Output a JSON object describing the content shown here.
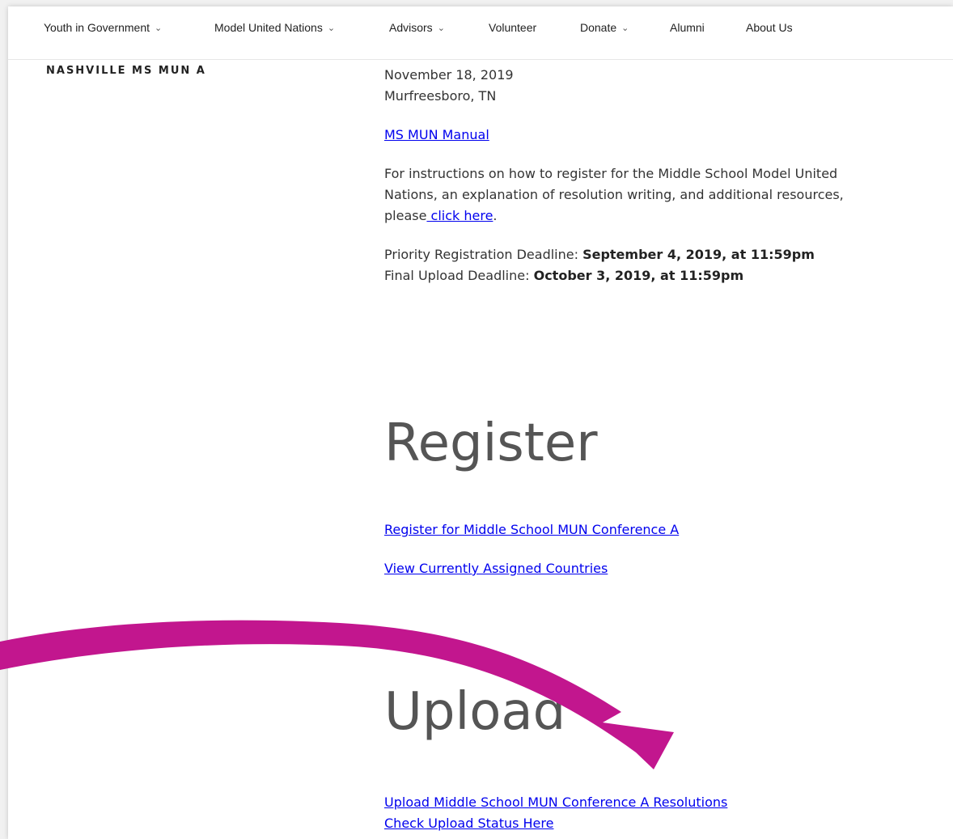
{
  "nav": {
    "items": [
      {
        "label": "Youth in Government",
        "caret": true
      },
      {
        "label": "Model United Nations",
        "caret": true
      },
      {
        "label": "Advisors",
        "caret": true
      },
      {
        "label": "Volunteer",
        "caret": false
      },
      {
        "label": "Donate",
        "caret": true
      },
      {
        "label": "Alumni",
        "caret": false
      },
      {
        "label": "About Us",
        "caret": false
      }
    ]
  },
  "sidebar": {
    "title": "NASHVILLE MS MUN A"
  },
  "event": {
    "date": "November 18, 2019",
    "location": "Murfreesboro, TN",
    "manual_link": "MS MUN Manual",
    "instructions_text": "For instructions on how to register for the Middle School Model United Nations, an explanation of resolution writing, and additional resources, please",
    "click_here_link": " click here",
    "instructions_end": ".",
    "priority_label": "Priority Registration Deadline: ",
    "priority_value": "September 4, 2019, at 11:59pm",
    "final_label": "Final Upload Deadline: ",
    "final_value": "October 3, 2019, at 11:59pm"
  },
  "register": {
    "heading": "Register",
    "register_link": "Register for Middle School MUN Conference A",
    "view_link": "View Currently Assigned Countries"
  },
  "upload": {
    "heading": "Upload",
    "upload_link": "Upload Middle School MUN Conference A Resolutions",
    "status_link": "Check Upload Status Here"
  },
  "colors": {
    "arrow": "#c2168e",
    "link": "#0000ee"
  },
  "icons": {
    "caret": "chevron-down-icon",
    "annotation": "curved-arrow-icon"
  }
}
